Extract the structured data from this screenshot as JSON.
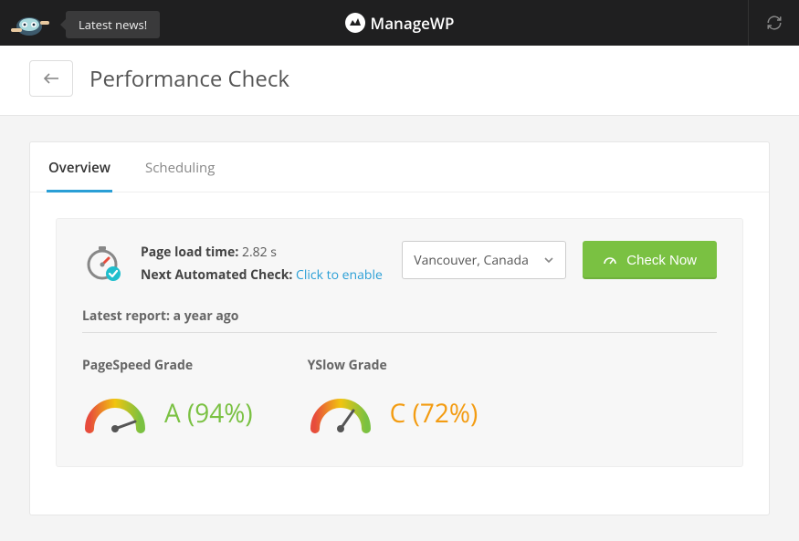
{
  "header": {
    "news_label": "Latest news!",
    "brand": "ManageWP"
  },
  "page": {
    "title": "Performance Check"
  },
  "tabs": [
    {
      "label": "Overview",
      "key": "overview",
      "active": true
    },
    {
      "label": "Scheduling",
      "key": "scheduling",
      "active": false
    }
  ],
  "summary": {
    "load_time_label": "Page load time:",
    "load_time_value": "2.82 s",
    "next_check_label": "Next Automated Check:",
    "next_check_action": "Click to enable",
    "location": "Vancouver, Canada",
    "check_button": "Check Now",
    "latest_report_label": "Latest report:",
    "latest_report_value": "a year ago"
  },
  "grades": {
    "pagespeed": {
      "title": "PageSpeed Grade",
      "letter": "A",
      "percent": 94,
      "score_text": "A (94%)",
      "color": "green"
    },
    "yslow": {
      "title": "YSlow Grade",
      "letter": "C",
      "percent": 72,
      "score_text": "C (72%)",
      "color": "orange"
    }
  },
  "colors": {
    "accent_green": "#7ac142",
    "accent_blue": "#2a9fd6",
    "accent_orange": "#f39c12"
  }
}
